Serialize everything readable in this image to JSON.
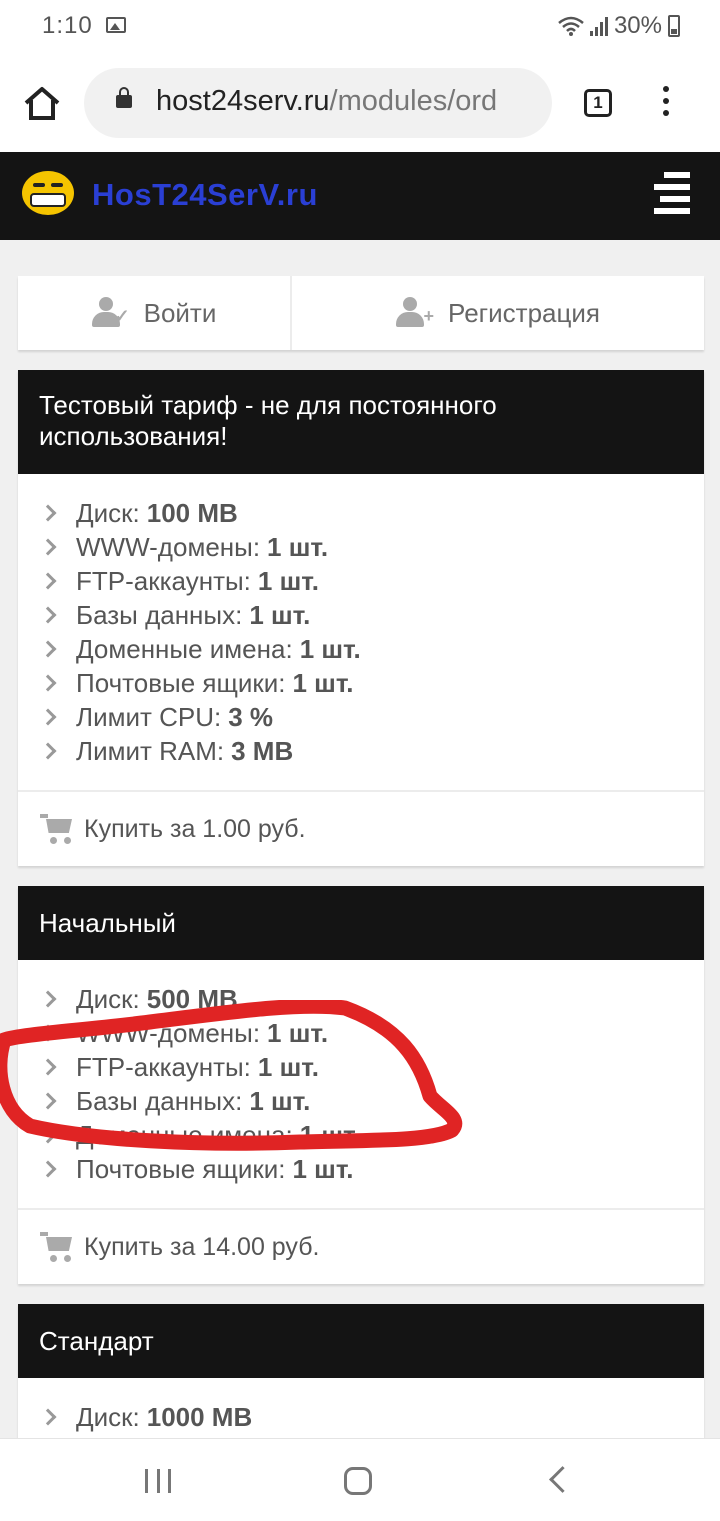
{
  "status_bar": {
    "time": "1:10",
    "battery": "30%",
    "icons": [
      "gallery-icon",
      "wifi-icon",
      "signal-icon",
      "battery-icon"
    ]
  },
  "browser": {
    "url_domain": "host24serv.ru",
    "url_path": "/modules/ord",
    "tab_count": "1",
    "icons": [
      "home-icon",
      "lock-icon",
      "tab-switcher-icon",
      "more-icon"
    ]
  },
  "site": {
    "logo_text": "HosT24SerV.ru",
    "brand_color": "#2a3fd4",
    "header_color": "#141414"
  },
  "auth": {
    "login_label": "Войти",
    "register_label": "Регистрация"
  },
  "plans": [
    {
      "title": "Тестовый тариф - не для постоянного использования!",
      "features": [
        {
          "label": "Диск:",
          "value": "100 MB"
        },
        {
          "label": "WWW-домены:",
          "value": "1 шт."
        },
        {
          "label": "FTP-аккаунты:",
          "value": "1 шт."
        },
        {
          "label": "Базы данных:",
          "value": "1 шт."
        },
        {
          "label": "Доменные имена:",
          "value": "1 шт."
        },
        {
          "label": "Почтовые ящики:",
          "value": "1 шт."
        },
        {
          "label": "Лимит CPU:",
          "value": "3 %"
        },
        {
          "label": "Лимит RAM:",
          "value": "3 MB"
        }
      ],
      "buy_label": "Купить за 1.00 руб."
    },
    {
      "title": "Начальный",
      "features": [
        {
          "label": "Диск:",
          "value": "500 MB"
        },
        {
          "label": "WWW-домены:",
          "value": "1 шт."
        },
        {
          "label": "FTP-аккаунты:",
          "value": "1 шт."
        },
        {
          "label": "Базы данных:",
          "value": "1 шт."
        },
        {
          "label": "Доменные имена:",
          "value": "1 шт."
        },
        {
          "label": "Почтовые ящики:",
          "value": "1 шт."
        }
      ],
      "buy_label": "Купить за 14.00 руб."
    },
    {
      "title": "Стандарт",
      "features": [
        {
          "label": "Диск:",
          "value": "1000 MB"
        }
      ]
    }
  ],
  "annotation_color": "#e02424",
  "nav_icons": [
    "recent-apps-icon",
    "home-circle-icon",
    "back-icon"
  ]
}
